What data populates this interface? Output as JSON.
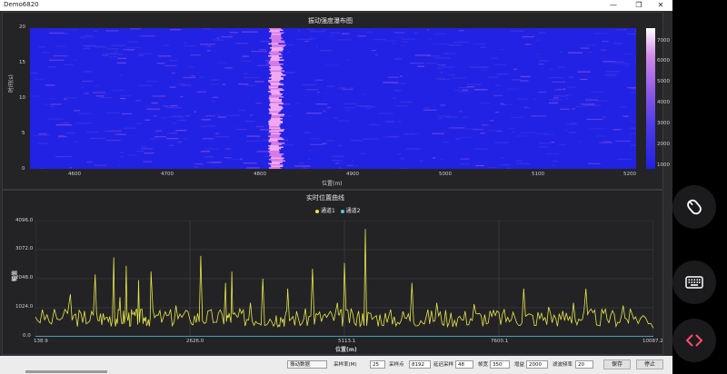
{
  "window": {
    "title": "Demo6820",
    "controls": {
      "minimize": "—",
      "restore": "❐",
      "close": "✕"
    }
  },
  "waterfall": {
    "title": "振动强度瀑布图",
    "xlabel": "位置(m)",
    "ylabel": "时间(s)",
    "x_ticks": [
      "4600",
      "4700",
      "4800",
      "4900",
      "5000",
      "5100",
      "5200"
    ],
    "y_ticks": [
      "20",
      "15",
      "10",
      "5",
      "0"
    ],
    "colorbar_ticks": [
      "7000",
      "6000",
      "5000",
      "4000",
      "3000",
      "2000",
      "1000"
    ]
  },
  "curve": {
    "title": "实时位置曲线",
    "xlabel": "位置(m)",
    "ylabel": "幅值",
    "legend": [
      {
        "name": "通道1",
        "color": "#e8e84a"
      },
      {
        "name": "通道2",
        "color": "#55c8d6"
      }
    ],
    "y_ticks": [
      "4096.0",
      "3072.0",
      "2048.0",
      "1024.0",
      "0.0"
    ],
    "x_ticks": [
      "138.9",
      "2626.0",
      "5113.1",
      "7600.1",
      "10087.2"
    ]
  },
  "chart_data": {
    "type": "line",
    "title": "实时位置曲线",
    "xlabel": "位置(m)",
    "ylabel": "幅值",
    "xlim": [
      138.9,
      10087.2
    ],
    "ylim": [
      0,
      4096
    ],
    "x": [
      138.9,
      400,
      700,
      900,
      1100,
      1250,
      1400,
      1500,
      1600,
      1700,
      1800,
      1900,
      2000,
      2200,
      2400,
      2626.0,
      2800,
      3000,
      3200,
      3300,
      3400,
      3600,
      3800,
      4000,
      4100,
      4200,
      4400,
      4600,
      4800,
      5000,
      5113.1,
      5300,
      5450,
      5600,
      5800,
      6000,
      6200,
      6400,
      6600,
      6800,
      7000,
      7200,
      7400,
      7600.1,
      7800,
      8000,
      8200,
      8400,
      8600,
      8800,
      9000,
      9200,
      9400,
      9600,
      9800,
      10087.2
    ],
    "series": [
      {
        "name": "通道1",
        "color": "#e8e84a",
        "values": [
          700,
          450,
          1500,
          500,
          2200,
          600,
          2800,
          1400,
          2500,
          800,
          2000,
          550,
          2300,
          700,
          1100,
          600,
          2850,
          500,
          1900,
          2300,
          700,
          1200,
          2050,
          500,
          600,
          1700,
          400,
          2400,
          800,
          1200,
          2600,
          400,
          3800,
          700,
          500,
          450,
          1900,
          450,
          1200,
          500,
          600,
          1150,
          450,
          850,
          600,
          1700,
          400,
          1050,
          600,
          1200,
          1700,
          400,
          750,
          1100,
          700,
          300
        ]
      },
      {
        "name": "通道2",
        "color": "#55c8d6",
        "values": [
          10,
          10,
          10,
          10,
          10,
          10,
          10,
          10,
          10,
          10,
          10,
          10,
          10,
          10,
          10,
          10,
          10,
          10,
          10,
          10,
          10,
          10,
          10,
          10,
          10,
          10,
          10,
          10,
          10,
          10,
          10,
          10,
          10,
          10,
          10,
          10,
          10,
          10,
          10,
          10,
          10,
          10,
          10,
          10,
          10,
          10,
          10,
          10,
          10,
          10,
          10,
          10,
          10,
          10,
          10,
          10
        ]
      }
    ]
  },
  "statusbar": {
    "mode_select": "振动数据",
    "sample_rate_label": "采样率(M)",
    "sample_rate_value": "25",
    "sample_points_label": "采样点",
    "sample_points_value": "8192",
    "delay_label": "延迟采样",
    "delay_value": "48",
    "frame_label": "帧宽",
    "frame_value": "350",
    "gain_label": "增益",
    "gain_value": "2000",
    "refresh_label": "滤波频率",
    "refresh_value": "20",
    "save_button": "保存",
    "stop_button": "停止"
  }
}
